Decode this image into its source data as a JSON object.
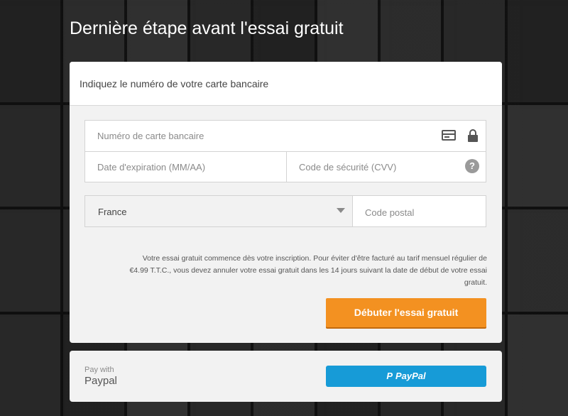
{
  "page_title": "Dernière étape avant l'essai gratuit",
  "card_header": "Indiquez le numéro de votre carte bancaire",
  "fields": {
    "card_number_placeholder": "Numéro de carte bancaire",
    "expiry_placeholder": "Date d'expiration (MM/AA)",
    "cvv_placeholder": "Code de sécurité (CVV)",
    "country_value": "France",
    "postal_placeholder": "Code postal"
  },
  "icons": {
    "card": "credit-card-icon",
    "lock": "lock-icon",
    "help": "?"
  },
  "legal_text": "Votre essai gratuit commence dès votre inscription. Pour éviter d'être facturé au tarif mensuel régulier de €4.99 T.T.C., vous devez annuler votre essai gratuit dans les 14 jours suivant la date de début de votre essai gratuit.",
  "cta_label": "Débuter l'essai gratuit",
  "paypal": {
    "pay_with": "Pay with",
    "label": "Paypal",
    "button_mark": "P",
    "button_text": "PayPal"
  },
  "colors": {
    "cta": "#f39121",
    "paypal": "#179bd7"
  }
}
